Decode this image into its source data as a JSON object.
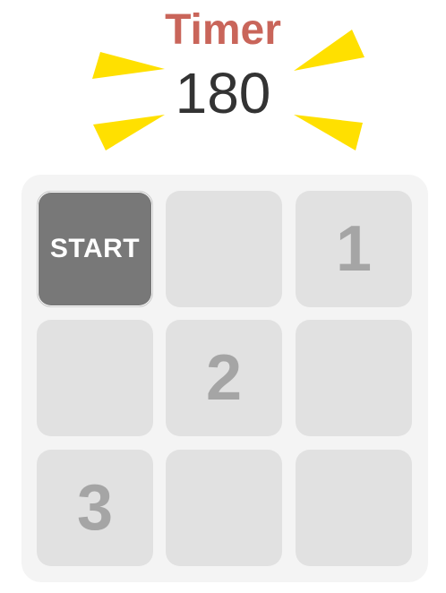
{
  "timer": {
    "title": "Timer",
    "value": "180"
  },
  "board": {
    "cells": [
      {
        "type": "start",
        "label": "START"
      },
      {
        "type": "empty",
        "label": ""
      },
      {
        "type": "number",
        "label": "1"
      },
      {
        "type": "empty",
        "label": ""
      },
      {
        "type": "number",
        "label": "2"
      },
      {
        "type": "empty",
        "label": ""
      },
      {
        "type": "number",
        "label": "3"
      },
      {
        "type": "empty",
        "label": ""
      },
      {
        "type": "empty",
        "label": ""
      }
    ]
  },
  "colors": {
    "timer_title": "#c9655a",
    "timer_value": "#333333",
    "rays": "#ffe000",
    "board_bg": "#f4f4f4",
    "cell_bg": "#e1e1e1",
    "cell_number": "#a5a5a5",
    "start_bg": "#787878"
  }
}
